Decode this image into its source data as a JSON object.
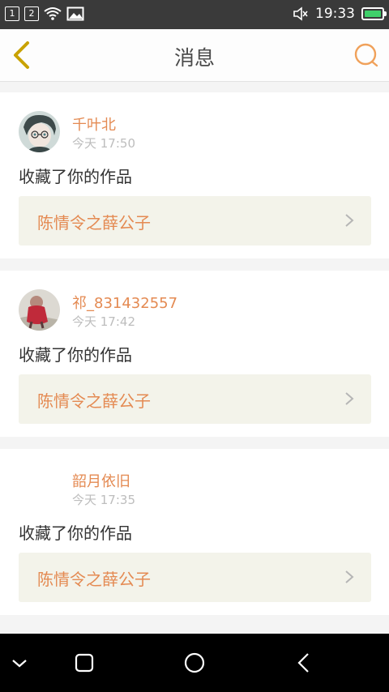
{
  "status_bar": {
    "sim1": "1",
    "sim2": "2",
    "time": "19:33",
    "icons": [
      "wifi-icon",
      "image-icon",
      "mute-icon",
      "battery-icon"
    ],
    "battery_color": "#3fd06a"
  },
  "header": {
    "title": "消息",
    "back_icon": "chevron-left-icon",
    "search_icon": "search-icon",
    "accent_back": "#c9a200",
    "accent_search": "#f0a15a"
  },
  "messages": [
    {
      "username": "千叶北",
      "time": "今天 17:50",
      "action": "收藏了你的作品",
      "work_title": "陈情令之薛公子",
      "avatar": "avatar-anime-boy"
    },
    {
      "username": "祁_831432557",
      "time": "今天 17:42",
      "action": "收藏了你的作品",
      "work_title": "陈情令之薛公子",
      "avatar": "avatar-child-photo"
    },
    {
      "username": "韶月依旧",
      "time": "今天 17:35",
      "action": "收藏了你的作品",
      "work_title": "陈情令之薛公子",
      "avatar": "avatar-blank"
    }
  ],
  "nav_bar": {
    "buttons": [
      "collapse-icon",
      "recents-icon",
      "home-icon",
      "back-icon"
    ]
  },
  "colors": {
    "username": "#e48a52",
    "link_bg": "#f3f3ea",
    "background": "#f4f4f4"
  }
}
